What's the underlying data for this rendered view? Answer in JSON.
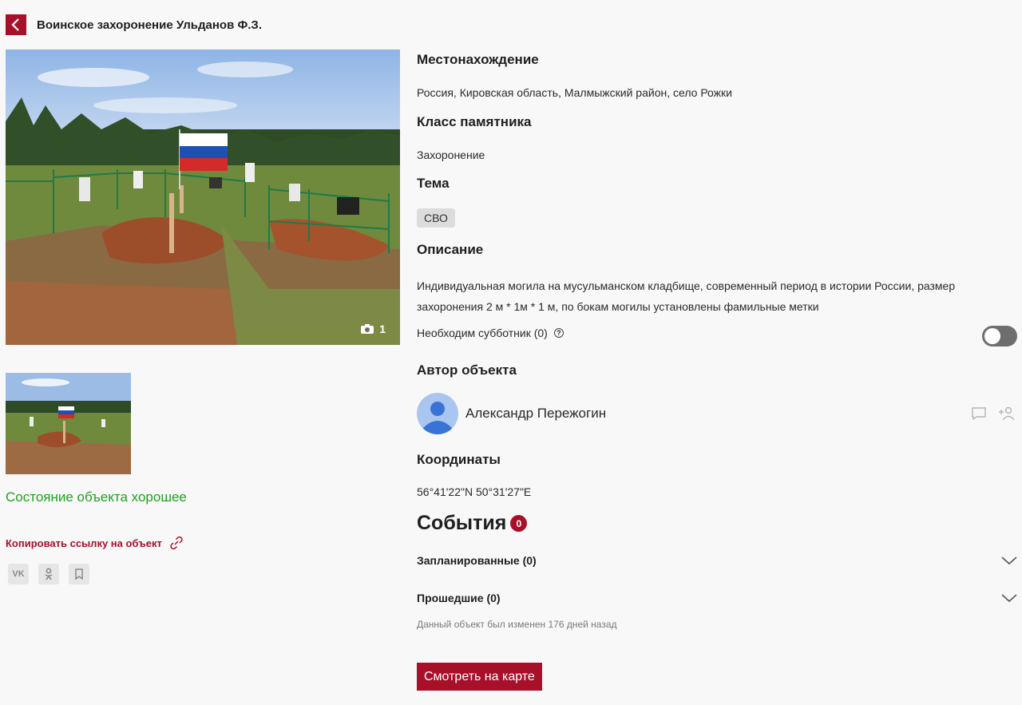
{
  "header": {
    "title": "Воинское захоронение Ульданов Ф.З."
  },
  "gallery": {
    "photo_count": "1"
  },
  "state": {
    "text": "Состояние объекта хорошее",
    "color": "#21a01f"
  },
  "copy_link": {
    "label": "Копировать ссылку на объект"
  },
  "share": {
    "vk": "VK",
    "ok": "OK"
  },
  "location": {
    "title": "Местонахождение",
    "value": "Россия, Кировская область, Малмыжский район, село Рожки"
  },
  "monument_class": {
    "title": "Класс памятника",
    "value": "Захоронение"
  },
  "theme": {
    "title": "Тема",
    "tag": "СВО"
  },
  "description": {
    "title": "Описание",
    "text": "Индивидуальная могила на мусульманском кладбище, современный период в истории России, размер захоронения 2 м * 1м * 1 м, по бокам могилы установлены фамильные метки"
  },
  "subbotnik": {
    "label": "Необходим субботник (0)",
    "help": "?",
    "enabled": false
  },
  "author": {
    "title": "Автор объекта",
    "name": "Александр Пережогин"
  },
  "coordinates": {
    "title": "Координаты",
    "value": "56°41'22\"N 50°31'27\"E"
  },
  "events": {
    "title": "События",
    "count": "0",
    "planned": "Запланированные (0)",
    "past": "Прошедшие (0)"
  },
  "changed": "Данный объект был изменен 176 дней назад",
  "map_button": "Смотреть на карте",
  "colors": {
    "accent": "#a8102a",
    "good_state": "#21a01f"
  }
}
